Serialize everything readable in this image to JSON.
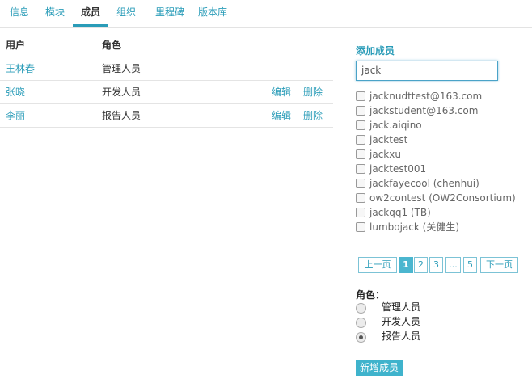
{
  "tabs": [
    "信息",
    "模块",
    "成员",
    "组织",
    "里程碑",
    "版本库"
  ],
  "members_table": {
    "headers": {
      "user": "用户",
      "role": "角色"
    },
    "rows": [
      {
        "user": "王林春",
        "role": "管理人员",
        "edit": "",
        "delete": ""
      },
      {
        "user": "张晓",
        "role": "开发人员",
        "edit": "编辑",
        "delete": "删除"
      },
      {
        "user": "李丽",
        "role": "报告人员",
        "edit": "编辑",
        "delete": "删除"
      }
    ]
  },
  "add_member": {
    "title": "添加成员",
    "search_value": "jack",
    "candidates": [
      "jacknudttest@163.com",
      "jackstudent@163.com",
      "jack.aiqino",
      "jacktest",
      "jackxu",
      "jacktest001",
      "jackfayecool (chenhui)",
      "ow2contest (OW2Consortium)",
      "jackqq1 (TB)",
      "lumbojack (关健生)"
    ],
    "pagination": {
      "prev": "上一页",
      "pages": [
        "1",
        "2",
        "3",
        "...",
        "5"
      ],
      "next": "下一页",
      "current": "1"
    },
    "role_title": "角色：",
    "roles": [
      "管理人员",
      "开发人员",
      "报告人员"
    ],
    "selected_role": "报告人员",
    "submit_label": "新增成员"
  },
  "colors": {
    "accent": "#2a9cb8",
    "button": "#3fb3cc"
  }
}
